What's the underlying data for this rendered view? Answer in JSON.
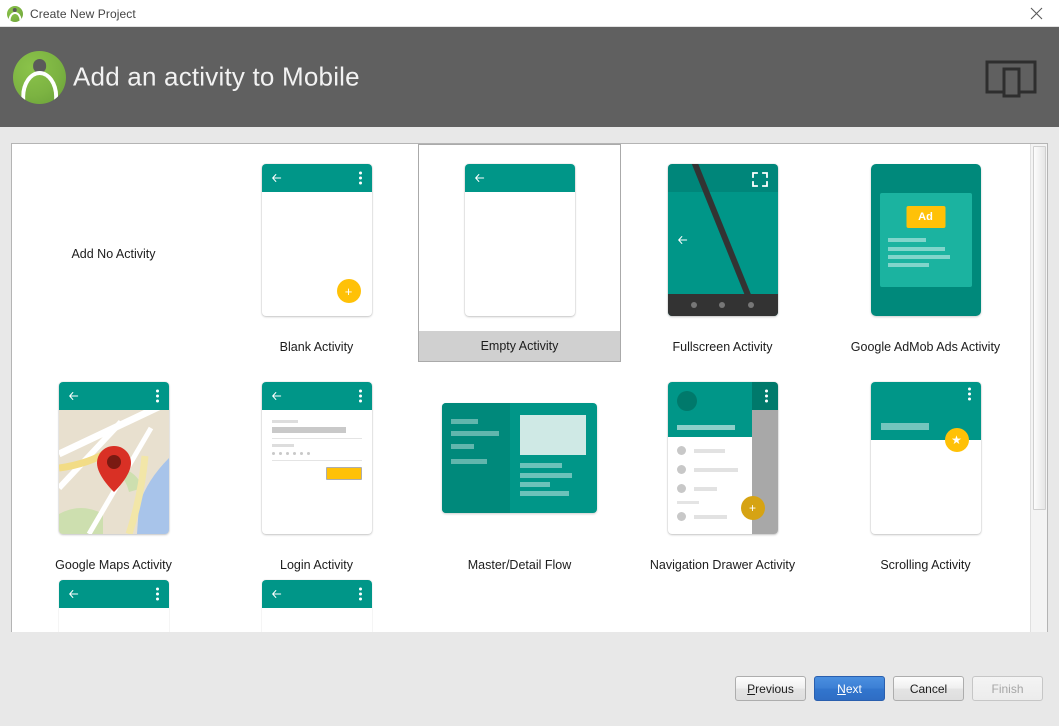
{
  "window": {
    "title": "Create New Project",
    "close_label": "✕",
    "app_icon": "android-studio-logo"
  },
  "header": {
    "title": "Add an activity to Mobile",
    "logo_icon": "android-studio-logo",
    "device_icon": "tablet-phone-icon"
  },
  "activities": {
    "rows": [
      [
        {
          "label": "Add No Activity",
          "thumb": "none",
          "selected": false
        },
        {
          "label": "Blank Activity",
          "thumb": "blank",
          "selected": false
        },
        {
          "label": "Empty Activity",
          "thumb": "empty",
          "selected": true
        },
        {
          "label": "Fullscreen Activity",
          "thumb": "fullscreen",
          "selected": false
        },
        {
          "label": "Google AdMob Ads Activity",
          "thumb": "admob",
          "selected": false
        }
      ],
      [
        {
          "label": "Google Maps Activity",
          "thumb": "maps",
          "selected": false
        },
        {
          "label": "Login Activity",
          "thumb": "login",
          "selected": false
        },
        {
          "label": "Master/Detail Flow",
          "thumb": "master",
          "selected": false
        },
        {
          "label": "Navigation Drawer Activity",
          "thumb": "navdrawer",
          "selected": false
        },
        {
          "label": "Scrolling Activity",
          "thumb": "scrolling",
          "selected": false
        }
      ]
    ],
    "partial_row_count": 2,
    "admob_badge": "Ad",
    "fab_glyph": "+",
    "fab_star_glyph": "★"
  },
  "scrollbar": {
    "orientation": "vertical",
    "thumb_position_pct": 0,
    "thumb_size_pct": 75
  },
  "footer": {
    "buttons": [
      {
        "name": "previous",
        "label": "Previous",
        "mnemonic": "P",
        "state": "enabled",
        "style": "default"
      },
      {
        "name": "next",
        "label": "Next",
        "mnemonic": "N",
        "state": "enabled",
        "style": "primary"
      },
      {
        "name": "cancel",
        "label": "Cancel",
        "mnemonic": "",
        "state": "enabled",
        "style": "default"
      },
      {
        "name": "finish",
        "label": "Finish",
        "mnemonic": "",
        "state": "disabled",
        "style": "default"
      }
    ]
  },
  "colors": {
    "header_bg": "#606060",
    "teal": "#009688",
    "teal_dark": "#00796b",
    "amber": "#ffc107",
    "selection_bg": "#d0d0d0",
    "panel_bg": "#ffffff",
    "dialog_bg": "#e8e8e8",
    "primary_button": "#3276ce"
  }
}
